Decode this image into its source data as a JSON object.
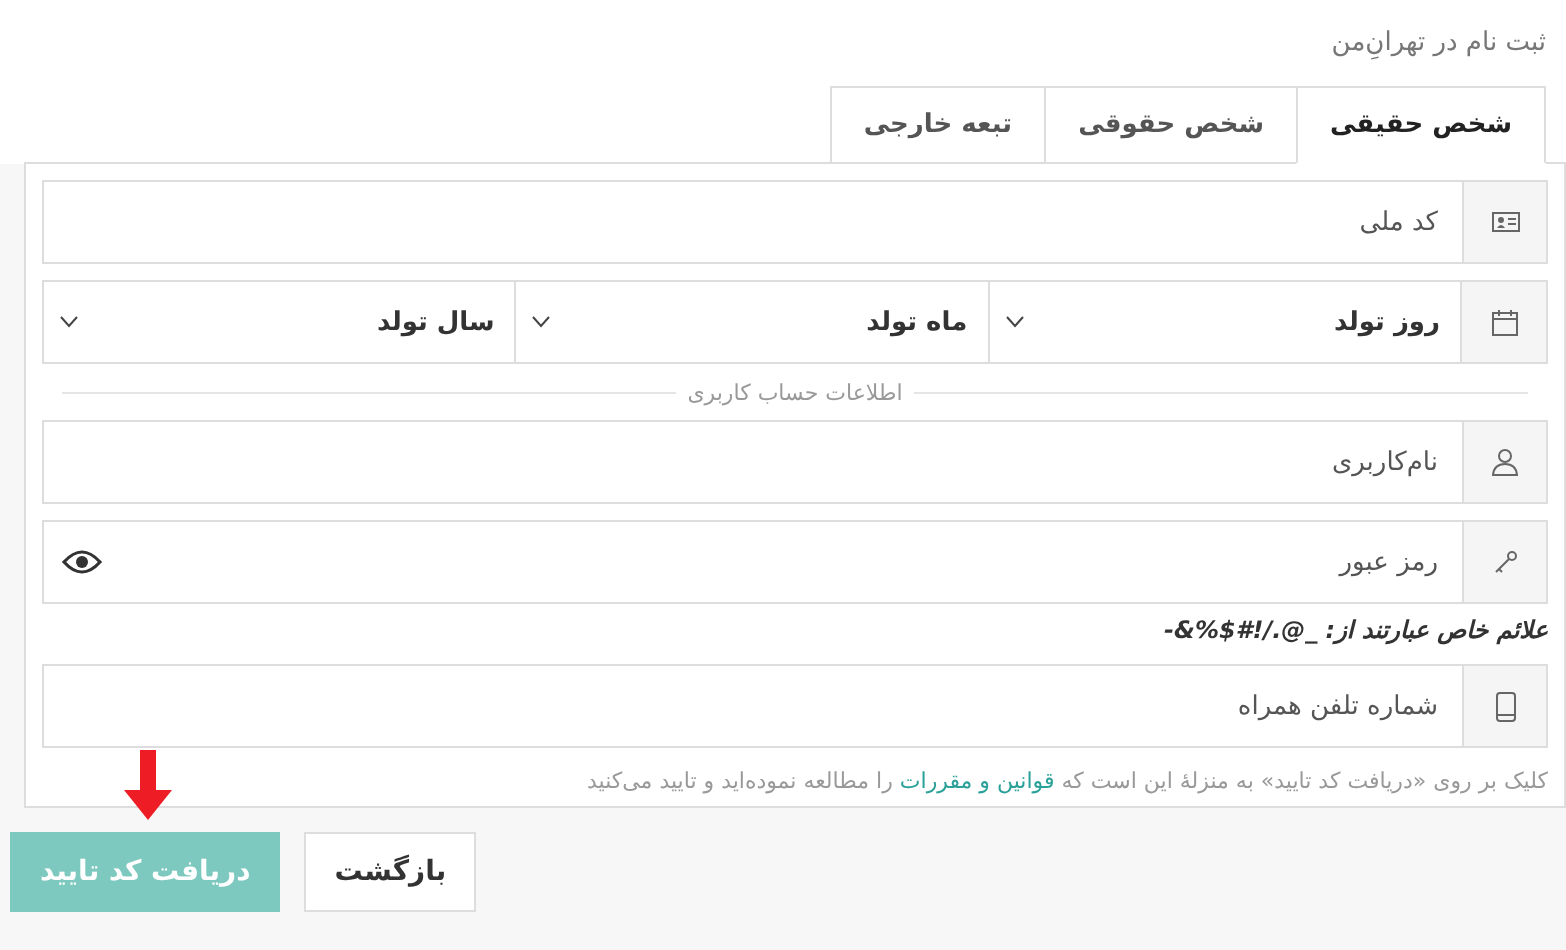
{
  "title": "ثبت نام در تهرانِ‌من",
  "tabs": [
    {
      "label": "شخص حقیقی",
      "selected": true
    },
    {
      "label": "شخص حقوقی",
      "selected": false
    },
    {
      "label": "تبعه خارجی",
      "selected": false
    }
  ],
  "national_id": {
    "placeholder": "کد ملی"
  },
  "birth_date": {
    "selects": [
      "روز تولد",
      "ماه تولد",
      "سال تولد"
    ]
  },
  "section_label": "اطلاعات حساب کاربری",
  "username": {
    "placeholder": "نام‌کاربری"
  },
  "password": {
    "placeholder": "رمز عبور"
  },
  "special_chars_note": "علائم خاص عبارتند از: _@./!#$%&-",
  "phone": {
    "placeholder": "شماره تلفن همراه"
  },
  "terms": {
    "before": "کلیک بر روی «دریافت کد تایید» به منزلهٔ این است که ",
    "link": "قوانین و مقررات",
    "after": " را مطالعه نموده‌اید و تایید می‌کنید"
  },
  "buttons": [
    {
      "label": "بازگشت",
      "kind": "secondary",
      "disabled": false
    },
    {
      "label": "دریافت کد تایید",
      "kind": "primary",
      "disabled": true
    }
  ]
}
